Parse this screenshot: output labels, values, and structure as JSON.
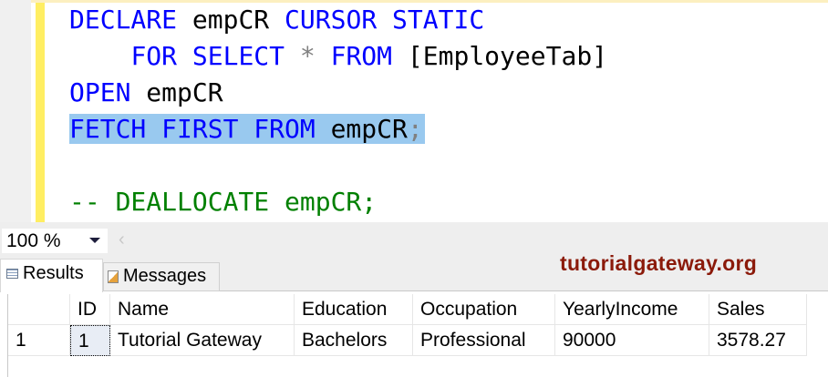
{
  "editor": {
    "lines": [
      {
        "kw1": "DECLARE",
        "id1": "empCR",
        "kw2": "CURSOR STATIC"
      },
      {
        "kw1": "FOR SELECT",
        "op": "*",
        "kw2": "FROM",
        "id1": "[EmployeeTab]"
      },
      {
        "kw1": "OPEN",
        "id1": "empCR"
      },
      {
        "kw1": "FETCH FIRST FROM",
        "id1": "empCR",
        "op": ";"
      },
      {
        "comment": "-- DEALLOCATE empCR;"
      }
    ]
  },
  "toolbar": {
    "zoom": "100 %",
    "scroll_left": "‹"
  },
  "tabs": [
    {
      "label": "Results"
    },
    {
      "label": "Messages"
    }
  ],
  "watermark": "tutorialgateway.org",
  "grid": {
    "columns": [
      "",
      "ID",
      "Name",
      "Education",
      "Occupation",
      "YearlyIncome",
      "Sales"
    ],
    "rows": [
      [
        "1",
        "1",
        "Tutorial Gateway",
        "Bachelors",
        "Professional",
        "90000",
        "3578.27"
      ]
    ]
  }
}
